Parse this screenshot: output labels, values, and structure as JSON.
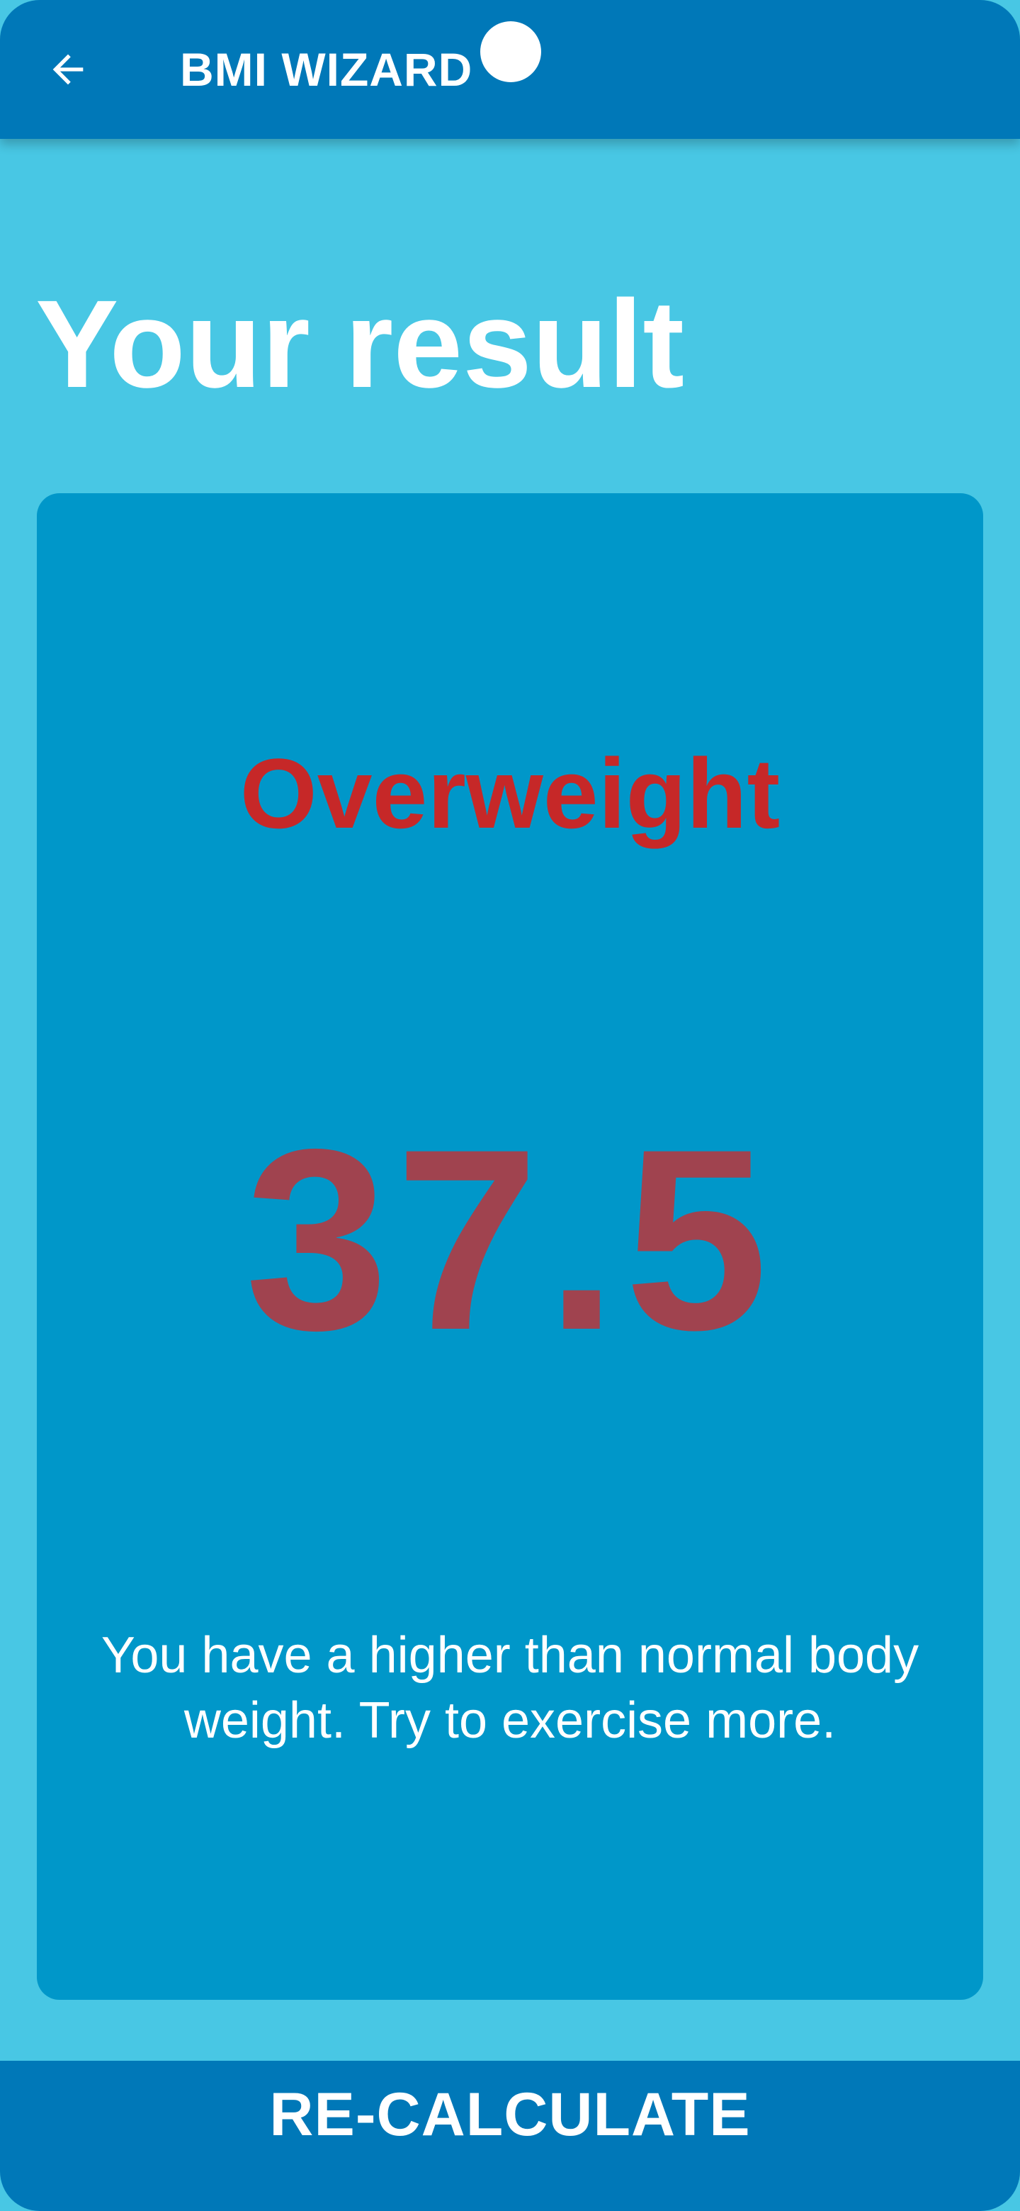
{
  "app_bar": {
    "title": "BMI WIZARD",
    "back_icon": "arrow-left-icon"
  },
  "page": {
    "title": "Your result"
  },
  "result": {
    "category": "Overweight",
    "bmi": "37.5",
    "message": "You have a higher than normal body weight. Try to exercise more."
  },
  "actions": {
    "recalculate_label": "RE-CALCULATE"
  },
  "colors": {
    "background": "#48c7e4",
    "app_bar": "#0078b8",
    "card": "#0097c9",
    "category_text": "#c62828",
    "bmi_text": "#a0434f",
    "button": "#0078b8",
    "text_light": "#ffffff"
  }
}
